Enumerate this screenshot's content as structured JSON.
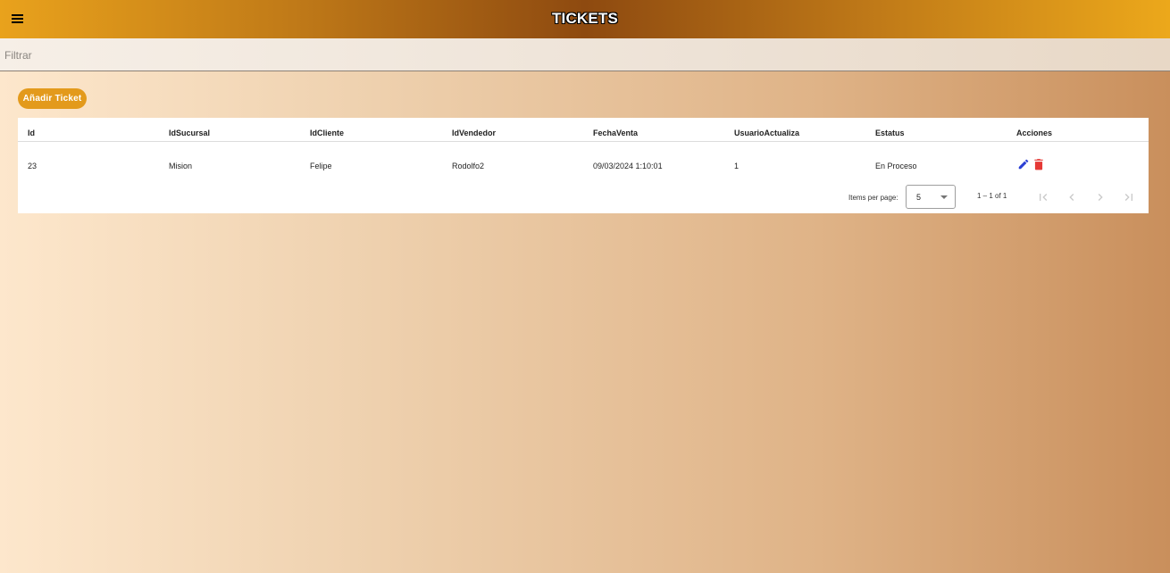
{
  "header": {
    "title": "TICKETS",
    "menu_icon": "menu-icon"
  },
  "filter": {
    "placeholder": "Filtrar",
    "value": ""
  },
  "add_button": {
    "label": "Añadir Ticket"
  },
  "table": {
    "columns": [
      "Id",
      "IdSucursal",
      "IdCliente",
      "IdVendedor",
      "FechaVenta",
      "UsuarioActualiza",
      "Estatus",
      "Acciones"
    ],
    "rows": [
      {
        "id": "23",
        "sucursal": "Mision",
        "cliente": "Felipe",
        "vendedor": "Rodolfo2",
        "fecha": "09/03/2024 1:10:01",
        "usuario": "1",
        "estatus": "En Proceso"
      }
    ]
  },
  "paginator": {
    "items_per_page_label": "Items per page:",
    "page_size": "5",
    "range_label": "1 – 1 of 1"
  },
  "colors": {
    "accent": "#e39a1c",
    "edit": "#2a3fd4",
    "delete": "#e53935"
  }
}
